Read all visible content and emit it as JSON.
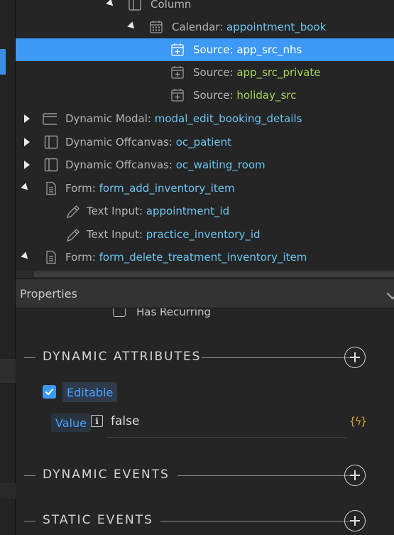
{
  "tree": {
    "rows": [
      {
        "label": "Column",
        "value": ""
      },
      {
        "label": "Calendar: ",
        "value": "appointment_book"
      },
      {
        "label": "Source: ",
        "value": "app_src_nhs"
      },
      {
        "label": "Source: ",
        "value": "app_src_private"
      },
      {
        "label": "Source: ",
        "value": "holiday_src"
      },
      {
        "label": "Dynamic Modal: ",
        "value": "modal_edit_booking_details"
      },
      {
        "label": "Dynamic Offcanvas: ",
        "value": "oc_patient"
      },
      {
        "label": "Dynamic Offcanvas: ",
        "value": "oc_waiting_room"
      },
      {
        "label": "Form: ",
        "value": "form_add_inventory_item"
      },
      {
        "label": "Text Input: ",
        "value": "appointment_id"
      },
      {
        "label": "Text Input: ",
        "value": "practice_inventory_id"
      },
      {
        "label": "Form: ",
        "value": "form_delete_treatment_inventory_item"
      }
    ]
  },
  "properties": {
    "title": "Properties",
    "has_recurring_label": "Has Recurring",
    "dynamic_attributes_title": "DYNAMIC ATTRIBUTES",
    "editable_label": "Editable",
    "value_label": "Value",
    "value_input": "false",
    "bolt_text": "{ϟ}",
    "dynamic_events_title": "DYNAMIC EVENTS",
    "static_events_title": "STATIC EVENTS"
  },
  "colors": {
    "accent": "#3d99f5",
    "label_cyan": "#6cc5f0",
    "label_green": "#a6d65a",
    "bolt": "#e0a030"
  },
  "icons": [
    "column-icon",
    "calendar-icon",
    "source-calendar-icon",
    "modal-icon",
    "offcanvas-icon",
    "form-icon",
    "pencil-icon",
    "info-icon",
    "plus-circle-icon",
    "lightning-icon",
    "check-icon"
  ]
}
